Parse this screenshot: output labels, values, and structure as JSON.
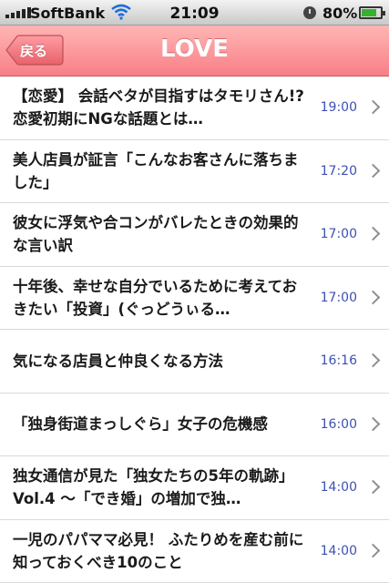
{
  "status_bar": {
    "carrier": "SoftBank",
    "time": "21:09",
    "battery_percent": "80%",
    "battery_level": 0.8
  },
  "nav": {
    "title": "LOVE",
    "back_label": "戻る"
  },
  "articles": [
    {
      "title": "【恋愛】 会話ベタが目指すはタモリさん!?　恋愛初期にNGな話題とは…",
      "time": "19:00"
    },
    {
      "title": "美人店員が証言「こんなお客さんに落ちました」",
      "time": "17:20"
    },
    {
      "title": "彼女に浮気や合コンがバレたときの効果的な言い訳",
      "time": "17:00"
    },
    {
      "title": "十年後、幸せな自分でいるために考えておきたい「投資」(ぐっどうぃる…",
      "time": "17:00"
    },
    {
      "title": "気になる店員と仲良くなる方法",
      "time": "16:16"
    },
    {
      "title": "「独身街道まっしぐら」女子の危機感",
      "time": "16:00"
    },
    {
      "title": "独女通信が見た「独女たちの5年の軌跡」Vol.4 ～「でき婚」の増加で独…",
      "time": "14:00"
    },
    {
      "title": "一児のパパママ必見！ ふたりめを産む前に知っておくべき10のこと",
      "time": "14:00"
    }
  ],
  "colors": {
    "nav_top": "#ffb5b5",
    "nav_bottom": "#f87f86",
    "time_text": "#3c50b4",
    "battery": "#35b130"
  }
}
